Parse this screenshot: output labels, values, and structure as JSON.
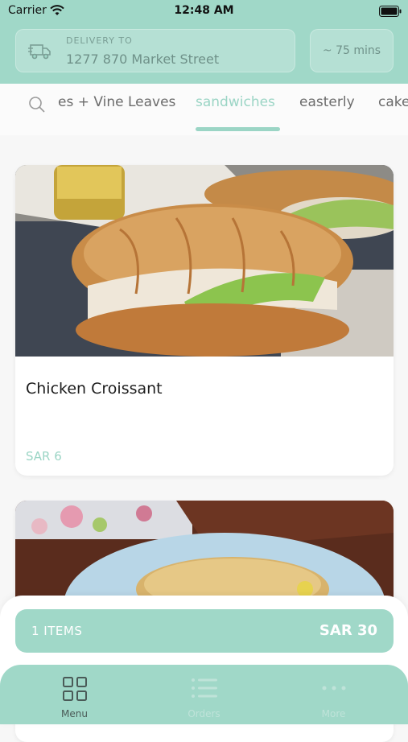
{
  "status_bar": {
    "carrier": "Carrier",
    "time": "12:48 AM"
  },
  "header": {
    "delivery_label": "DELIVERY TO",
    "delivery_address": "1277 870 Market Street",
    "eta": "~ 75 mins"
  },
  "categories": {
    "items": [
      {
        "label": "es + Vine Leaves"
      },
      {
        "label": "sandwiches"
      },
      {
        "label": "easterly"
      },
      {
        "label": "cake"
      }
    ],
    "active": "sandwiches"
  },
  "menu_items": [
    {
      "title": "Chicken Croissant",
      "price": "SAR 6"
    },
    {
      "title": "",
      "price": ""
    }
  ],
  "cart": {
    "count": "1 ITEMS",
    "total": "SAR 30"
  },
  "tabs": [
    {
      "label": "Menu",
      "icon": "grid-icon"
    },
    {
      "label": "Orders",
      "icon": "list-icon"
    },
    {
      "label": "More",
      "icon": "more-dots-icon"
    }
  ],
  "colors": {
    "accent": "#a0d8c8",
    "accent_text": "#9bd5c5",
    "background": "#f7f7f7"
  }
}
